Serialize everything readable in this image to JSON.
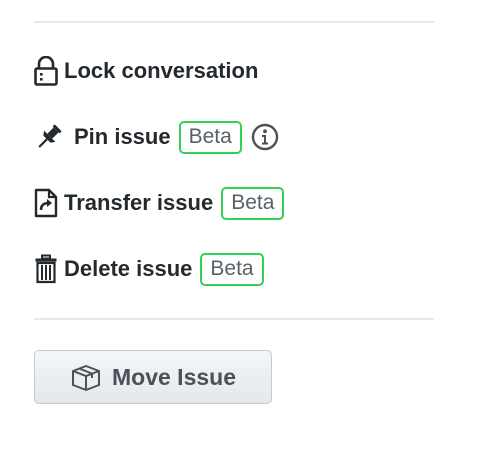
{
  "actions": {
    "lock": {
      "label": "Lock conversation",
      "icon": "lock-icon"
    },
    "pin": {
      "label": "Pin issue",
      "badge": "Beta",
      "icon": "pin-icon",
      "info_icon": "info-icon"
    },
    "transfer": {
      "label": "Transfer issue",
      "badge": "Beta",
      "icon": "transfer-icon"
    },
    "delete": {
      "label": "Delete issue",
      "badge": "Beta",
      "icon": "trash-icon"
    }
  },
  "move_button": {
    "label": "Move Issue",
    "icon": "package-icon"
  },
  "colors": {
    "text": "#24292e",
    "badge_border": "#34d058",
    "badge_text": "#586069",
    "divider": "#e6e8ea"
  }
}
